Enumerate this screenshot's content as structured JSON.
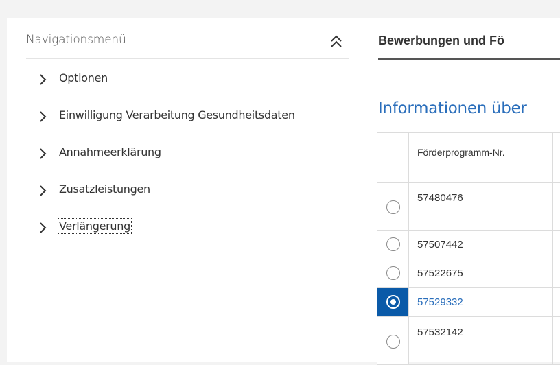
{
  "nav": {
    "title": "Navigationsmenü",
    "items": [
      {
        "label": "Optionen"
      },
      {
        "label": "Einwilligung Verarbeitung Gesundheitsdaten"
      },
      {
        "label": "Annahmeerklärung"
      },
      {
        "label": "Zusatzleistungen"
      },
      {
        "label": "Verlängerung"
      }
    ]
  },
  "main": {
    "tab_title": "Bewerbungen und Fö",
    "section_title": "Informationen über",
    "table": {
      "header": "Förderprogramm-Nr.",
      "rows": [
        {
          "number": "57480476",
          "selected": false
        },
        {
          "number": "57507442",
          "selected": false
        },
        {
          "number": "57522675",
          "selected": false
        },
        {
          "number": "57529332",
          "selected": true
        },
        {
          "number": "57532142",
          "selected": false
        }
      ]
    }
  },
  "colors": {
    "accent": "#2a6ebb",
    "selected_bg": "#0a5aa8"
  },
  "icons": {
    "collapse": "double-chevron-up-icon",
    "nav_item": "chevron-right-icon"
  }
}
